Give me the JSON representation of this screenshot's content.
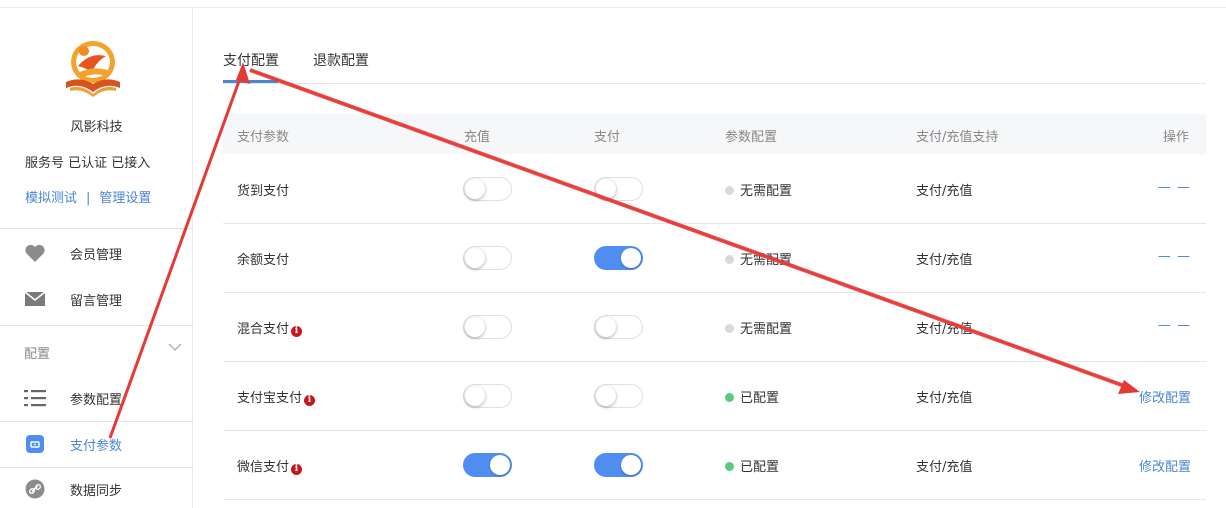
{
  "sidebar": {
    "org_name": "风影科技",
    "org_status": "服务号 已认证 已接入",
    "links": [
      "模拟测试",
      "管理设置"
    ],
    "link_separator": "|",
    "nav_items": [
      {
        "label": "会员管理",
        "icon": "heart-icon"
      },
      {
        "label": "留言管理",
        "icon": "envelope-icon"
      }
    ],
    "group_label": "配置",
    "group_items": [
      {
        "label": "参数配置",
        "icon": "list-settings-icon"
      },
      {
        "label": "支付参数",
        "icon": "payment-card-icon",
        "active": true
      },
      {
        "label": "数据同步",
        "icon": "sync-link-icon"
      }
    ]
  },
  "tabs": [
    {
      "label": "支付配置",
      "active": true
    },
    {
      "label": "退款配置",
      "active": false
    }
  ],
  "table": {
    "headers": [
      "支付参数",
      "充值",
      "支付",
      "参数配置",
      "支付/充值支持",
      "操作"
    ],
    "rows": [
      {
        "name": "货到支付",
        "info": false,
        "recharge_on": false,
        "pay_on": false,
        "config_status": "无需配置",
        "status_color": "#d9d9d9",
        "support": "支付/充值",
        "action": "— —"
      },
      {
        "name": "余额支付",
        "info": false,
        "recharge_on": false,
        "pay_on": true,
        "config_status": "无需配置",
        "status_color": "#d9d9d9",
        "support": "支付/充值",
        "action": "— —"
      },
      {
        "name": "混合支付",
        "info": true,
        "recharge_on": false,
        "pay_on": false,
        "config_status": "无需配置",
        "status_color": "#d9d9d9",
        "support": "支付/充值",
        "action": "— —"
      },
      {
        "name": "支付宝支付",
        "info": true,
        "recharge_on": false,
        "pay_on": false,
        "config_status": "已配置",
        "status_color": "#5cc97b",
        "support": "支付/充值",
        "action": "修改配置"
      },
      {
        "name": "微信支付",
        "info": true,
        "recharge_on": true,
        "pay_on": true,
        "config_status": "已配置",
        "status_color": "#5cc97b",
        "support": "支付/充值",
        "action": "修改配置"
      }
    ]
  },
  "colors": {
    "accent": "#4a86d4",
    "toggle_on": "#4f8ef0",
    "annotation": "#e53935",
    "info_badge": "#c8161d"
  }
}
